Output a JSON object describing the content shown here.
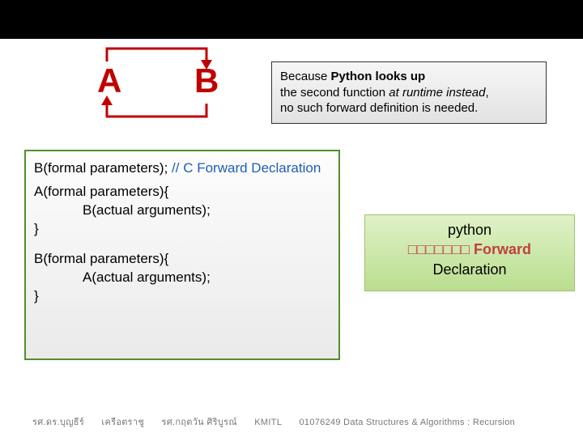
{
  "ab": {
    "A": "A",
    "B": "B"
  },
  "info": {
    "line1_pre": "Because ",
    "line1_bold": "Python looks up",
    "line2_pre": "the second function ",
    "line2_it": "at runtime instead",
    "line2_post": ",",
    "line3": "no such forward definition is needed."
  },
  "code": {
    "l1_a": "B(formal parameters); ",
    "l1_b": "// C Forward Declaration",
    "l2": "A(formal parameters){",
    "l3": "B(actual arguments);",
    "l4": "}",
    "l5": "B(formal parameters){",
    "l6": "A(actual arguments);",
    "l7": "}"
  },
  "note": {
    "r1": "python",
    "r2_placeholder": "□□□□□□□",
    "r2_word": "Forward",
    "r3": "Declaration"
  },
  "footer": {
    "a": "รศ.ดร.บุญธีร์",
    "b": "เครือตราชู",
    "c": "รศ.กฤตวัน   ศิริบูรณ์",
    "d": "KMITL",
    "e": "01076249 Data Structures & Algorithms : Recursion"
  }
}
